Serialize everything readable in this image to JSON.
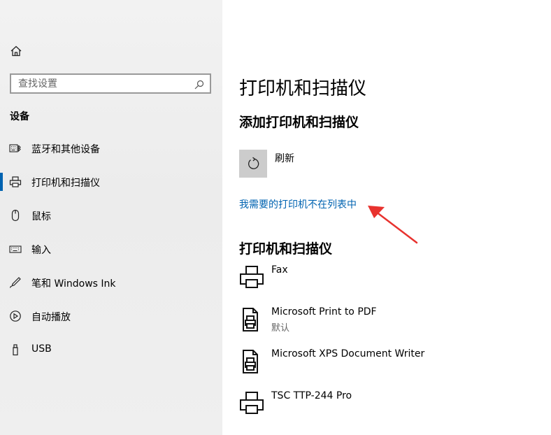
{
  "sidebar": {
    "search_placeholder": "查找设置",
    "section_title": "设备",
    "items": [
      {
        "label": "蓝牙和其他设备",
        "icon": "keyboard-bluetooth-icon",
        "active": false
      },
      {
        "label": "打印机和扫描仪",
        "icon": "printer-icon",
        "active": true
      },
      {
        "label": "鼠标",
        "icon": "mouse-icon",
        "active": false
      },
      {
        "label": "输入",
        "icon": "keyboard-icon",
        "active": false
      },
      {
        "label": "笔和 Windows Ink",
        "icon": "pen-icon",
        "active": false
      },
      {
        "label": "自动播放",
        "icon": "autoplay-icon",
        "active": false
      },
      {
        "label": "USB",
        "icon": "usb-icon",
        "active": false
      }
    ]
  },
  "main": {
    "title": "打印机和扫描仪",
    "add_heading": "添加打印机和扫描仪",
    "refresh_label": "刷新",
    "not_listed_link": "我需要的打印机不在列表中",
    "list_heading": "打印机和扫描仪",
    "printers": [
      {
        "name": "Fax",
        "sub": "",
        "icon": "fax-printer-icon"
      },
      {
        "name": "Microsoft Print to PDF",
        "sub": "默认",
        "icon": "document-printer-icon"
      },
      {
        "name": "Microsoft XPS Document Writer",
        "sub": "",
        "icon": "document-printer-icon"
      },
      {
        "name": "TSC TTP-244 Pro",
        "sub": "",
        "icon": "printer-icon"
      }
    ]
  },
  "colors": {
    "accent": "#0063b1",
    "annotation_arrow": "#e8322e"
  }
}
